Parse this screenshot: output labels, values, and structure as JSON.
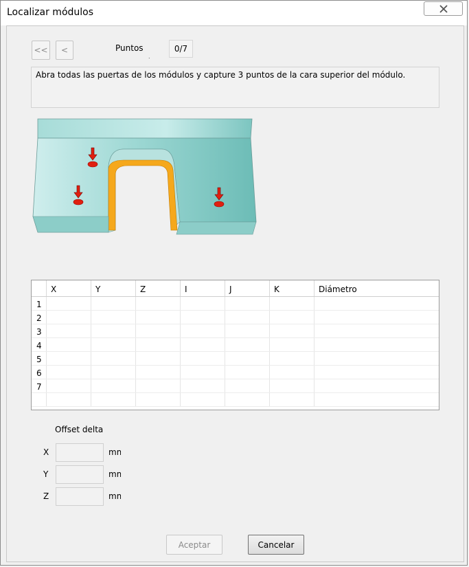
{
  "window": {
    "title": "Localizar módulos"
  },
  "nav": {
    "first_label": "<<",
    "prev_label": "<"
  },
  "points": {
    "label": "Puntos",
    "dot": ".",
    "counter": "0/7"
  },
  "instructions": "Abra todas las puertas de los módulos y capture 3 puntos de la cara superior del módulo.",
  "table": {
    "columns": [
      "X",
      "Y",
      "Z",
      "I",
      "J",
      "K",
      "Diámetro"
    ],
    "row_numbers": [
      "1",
      "2",
      "3",
      "4",
      "5",
      "6",
      "7"
    ]
  },
  "offset": {
    "title": "Offset delta",
    "x_label": "X",
    "y_label": "Y",
    "z_label": "Z",
    "x_value": "",
    "y_value": "",
    "z_value": "",
    "unit": "mm"
  },
  "buttons": {
    "accept": "Aceptar",
    "cancel": "Cancelar"
  },
  "colors": {
    "module_face": "#8fd0cc",
    "inner_edge": "#f5a81c",
    "marker": "#e02010"
  }
}
